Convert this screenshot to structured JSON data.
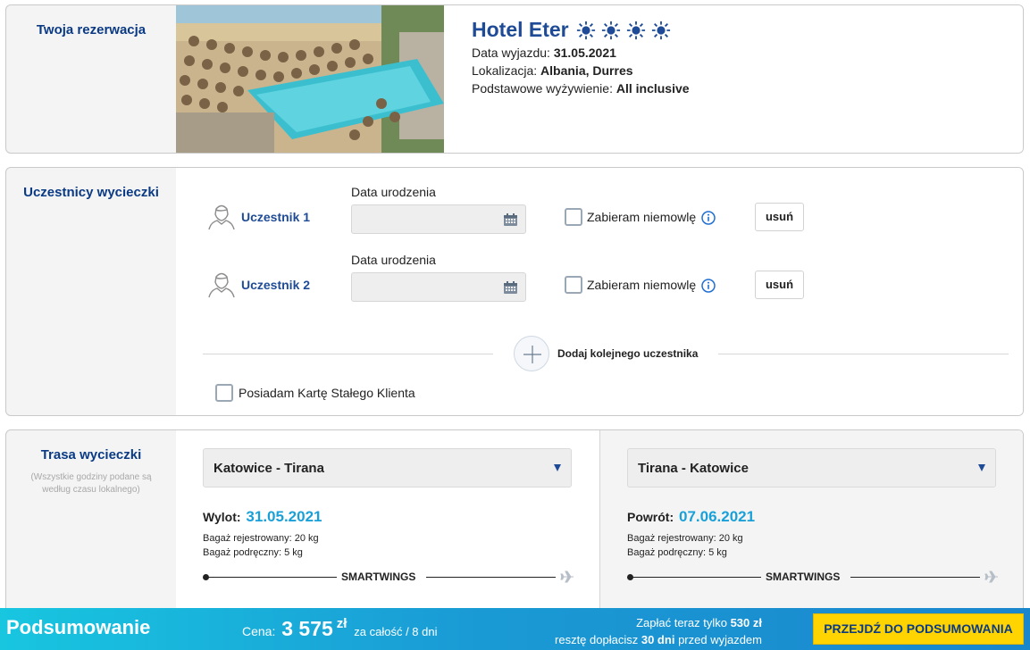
{
  "reservation": {
    "section_title": "Twoja rezerwacja",
    "hotel_name": "Hotel Eter",
    "stars": 4,
    "departure_label": "Data wyjazdu:",
    "departure_value": "31.05.2021",
    "location_label": "Lokalizacja:",
    "location_value": "Albania, Durres",
    "board_label": "Podstawowe wyżywienie:",
    "board_value": "All inclusive"
  },
  "participants": {
    "section_title": "Uczestnicy wycieczki",
    "items": [
      {
        "name": "Uczestnik 1",
        "date_label": "Data urodzenia",
        "date_value": "",
        "infant_label": "Zabieram niemowlę",
        "infant_checked": false,
        "remove_label": "usuń"
      },
      {
        "name": "Uczestnik 2",
        "date_label": "Data urodzenia",
        "date_value": "",
        "infant_label": "Zabieram niemowlę",
        "infant_checked": false,
        "remove_label": "usuń"
      }
    ],
    "add_label": "Dodaj kolejnego uczestnika",
    "loyalty_label": "Posiadam Kartę Stałego Klienta",
    "loyalty_checked": false
  },
  "route": {
    "section_title": "Trasa wycieczki",
    "note": "(Wszystkie godziny podane są według czasu lokalnego)",
    "outbound": {
      "route": "Katowice - Tirana",
      "date_label": "Wylot:",
      "date_value": "31.05.2021",
      "bag_checked": "Bagaż rejestrowany: 20 kg",
      "bag_hand": "Bagaż podręczny: 5 kg",
      "airline": "SMARTWINGS"
    },
    "inbound": {
      "route": "Tirana - Katowice",
      "date_label": "Powrót:",
      "date_value": "07.06.2021",
      "bag_checked": "Bagaż rejestrowany: 20 kg",
      "bag_hand": "Bagaż podręczny: 5 kg",
      "airline": "SMARTWINGS"
    }
  },
  "summary": {
    "title": "Podsumowanie",
    "price_label": "Cena:",
    "price_value": "3 575",
    "currency": "zł",
    "price_desc": "za całość / 8 dni",
    "pay_now_prefix": "Zapłać teraz tylko",
    "pay_now_value": "530 zł",
    "rest_prefix": "resztę dopłacisz",
    "rest_days": "30 dni",
    "rest_suffix": "przed wyjazdem",
    "cta_label": "PRZEJDŹ DO PODSUMOWANIA"
  },
  "colors": {
    "brand_blue": "#1f4b96",
    "date_accent": "#1aa0d8",
    "cta_yellow": "#ffd400"
  }
}
